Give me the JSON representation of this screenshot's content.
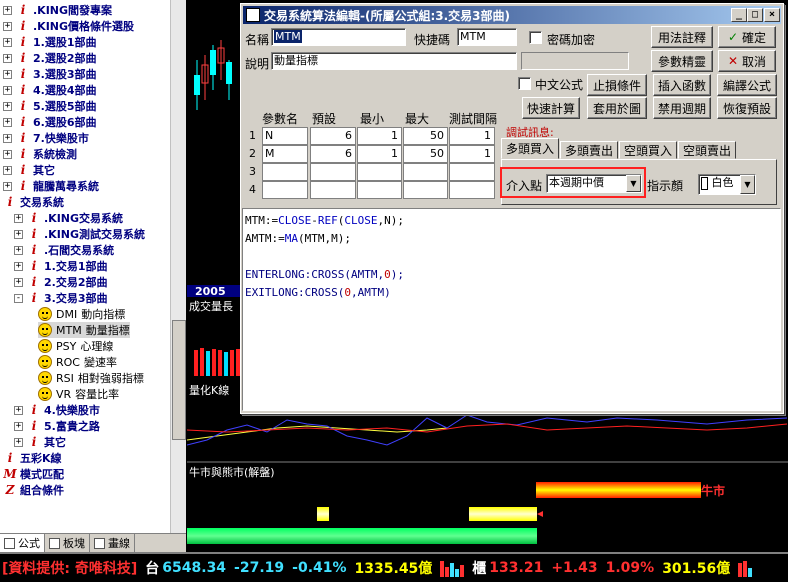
{
  "sidebar": {
    "items": [
      {
        "icon": "i",
        "label": ".KING閻發專案",
        "expander": "+"
      },
      {
        "icon": "i",
        "label": ".KING價格條件選股",
        "expander": "+"
      },
      {
        "icon": "i",
        "label": "1.選股1部曲",
        "expander": "+"
      },
      {
        "icon": "i",
        "label": "2.選股2部曲",
        "expander": "+"
      },
      {
        "icon": "i",
        "label": "3.選股3部曲",
        "expander": "+"
      },
      {
        "icon": "i",
        "label": "4.選股4部曲",
        "expander": "+"
      },
      {
        "icon": "i",
        "label": "5.選股5部曲",
        "expander": "+"
      },
      {
        "icon": "i",
        "label": "6.選股6部曲",
        "expander": "+"
      },
      {
        "icon": "i",
        "label": "7.快樂股市",
        "expander": "+"
      },
      {
        "icon": "i",
        "label": "系統檢測",
        "expander": "+"
      },
      {
        "icon": "i",
        "label": "其它",
        "expander": "+"
      },
      {
        "icon": "i",
        "label": "龍騰萬尋系統",
        "expander": "+"
      },
      {
        "icon": "i",
        "label": "交易系統",
        "expander": ""
      },
      {
        "icon": "i",
        "label": ".KING交易系統",
        "expander": "+"
      },
      {
        "icon": "i",
        "label": ".KING測試交易系統",
        "expander": "+"
      },
      {
        "icon": "i",
        "label": ".石閻交易系統",
        "expander": "+"
      },
      {
        "icon": "i",
        "label": "1.交易1部曲",
        "expander": "+"
      },
      {
        "icon": "i",
        "label": "2.交易2部曲",
        "expander": "+"
      },
      {
        "icon": "i",
        "label": "3.交易3部曲",
        "expander": "-"
      }
    ],
    "subitems": [
      {
        "code": "DMI",
        "name": "動向指標"
      },
      {
        "code": "MTM",
        "name": "動量指標"
      },
      {
        "code": "PSY",
        "name": "心理線"
      },
      {
        "code": "ROC",
        "name": "變速率"
      },
      {
        "code": "RSI",
        "name": "相對強弱指標"
      },
      {
        "code": "VR",
        "name": "容量比率"
      }
    ],
    "tail_items": [
      {
        "icon": "i",
        "label": "4.快樂股市",
        "expander": "+"
      },
      {
        "icon": "i",
        "label": "5.富貴之路",
        "expander": "+"
      },
      {
        "icon": "i",
        "label": "其它",
        "expander": "+"
      }
    ],
    "root_items": [
      {
        "icon": "i",
        "label": "五彩K線"
      },
      {
        "icon": "M",
        "label": "模式匹配"
      },
      {
        "icon": "Z",
        "label": "組合條件"
      }
    ],
    "bottom_tabs": [
      "公式",
      "板塊",
      "畫線"
    ]
  },
  "chart": {
    "year_label": "2005",
    "vol_label": "成交量長",
    "kline_label": "量化K線",
    "bull_bear_label": "牛市與熊市(解盤)",
    "bull_text": "牛市"
  },
  "dialog": {
    "title": "交易系統算法編輯-(所屬公式組:3.交易3部曲)",
    "name_label": "名稱",
    "name_value": "MTM",
    "shortcut_label": "快捷碼",
    "shortcut_value": "MTM",
    "password_label": "密碼加密",
    "desc_label": "說明",
    "desc_value": "動量指標",
    "chinese_formula_label": "中文公式",
    "buttons": {
      "usage_notes": "用法註釋",
      "ok": "確定",
      "param_tune": "參數精靈",
      "cancel": "取消",
      "stop_condition": "止損條件",
      "insert_func": "插入函數",
      "compile": "編譯公式",
      "quick_calc": "快速計算",
      "apply_chart": "套用於圖",
      "disable_period": "禁用週期",
      "restore_default": "恢復預設"
    },
    "params": {
      "headers": [
        "參數名",
        "預設",
        "最小",
        "最大",
        "測試間隔"
      ],
      "rows": [
        {
          "num": "1",
          "name": "N",
          "default": "6",
          "min": "1",
          "max": "50",
          "step": "1"
        },
        {
          "num": "2",
          "name": "M",
          "default": "6",
          "min": "1",
          "max": "50",
          "step": "1"
        },
        {
          "num": "3",
          "name": "",
          "default": "",
          "min": "",
          "max": "",
          "step": ""
        },
        {
          "num": "4",
          "name": "",
          "default": "",
          "min": "",
          "max": "",
          "step": ""
        }
      ]
    },
    "debug_label": "調試訊息:",
    "tabs": [
      "多頭買入",
      "多頭賣出",
      "空頭買入",
      "空頭賣出"
    ],
    "entry_point_label": "介入點",
    "entry_point_value": "本週期中價",
    "indicator_color_label": "指示顏",
    "indicator_color_value": "白色",
    "code": [
      "MTM:=CLOSE-REF(CLOSE,N);",
      "AMTM:=MA(MTM,M);",
      "",
      "ENTERLONG:CROSS(AMTM,0);",
      "EXITLONG:CROSS(0,AMTM)"
    ]
  },
  "statusbar": {
    "provider": "[資料提供: 奇唯科技]",
    "tai_label": "台",
    "tai_index": "6548.34",
    "tai_change": "-27.19",
    "tai_pct": "-0.41%",
    "tai_volume": "1335.45億",
    "otc_label": "櫃",
    "otc_index": "133.21",
    "otc_change": "+1.43",
    "otc_pct": "1.09%",
    "otc_volume": "301.56億"
  },
  "colors": {
    "accent_title": "#0a246a",
    "status_red": "#ff3030",
    "status_cyan": "#40e0ff",
    "status_yellow": "#ffff00"
  }
}
